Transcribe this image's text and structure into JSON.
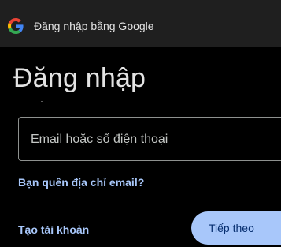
{
  "header": {
    "logo_icon": "google-g-icon",
    "title": "Đăng nhập bằng Google"
  },
  "main": {
    "heading": "Đăng nhập",
    "identifier_input": {
      "placeholder": "Email hoặc số điện thoại",
      "value": ""
    },
    "forgot_email_link": "Bạn quên địa chỉ email?",
    "create_account_link": "Tạo tài khoản",
    "next_button": "Tiếp theo"
  },
  "colors": {
    "background": "#000000",
    "header_background": "#1f1f1f",
    "link": "#a8c7fa",
    "primary_button": "#a8c7fa",
    "primary_button_text": "#062e6f",
    "text": "#e3e3e3"
  }
}
